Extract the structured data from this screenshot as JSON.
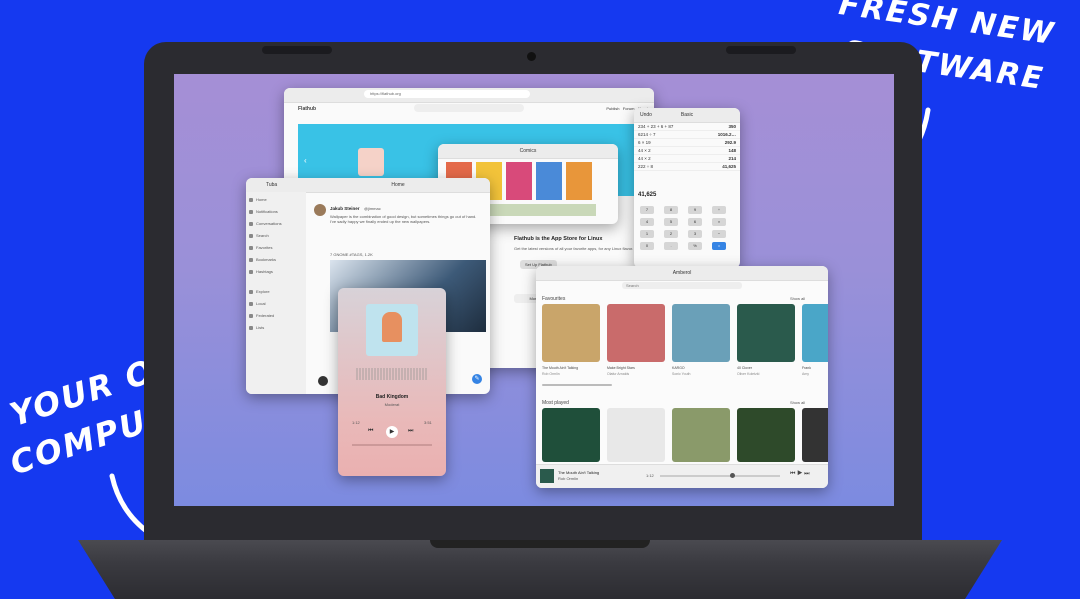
{
  "annotations": {
    "fresh": "FRESH NEW",
    "software": "SOFTWARE",
    "your_old": "YOUR OLD",
    "computer": "COMPUTER"
  },
  "flathub": {
    "url": "https://flathub.org",
    "tab": "Flathub",
    "nav": [
      "Publish",
      "Forum",
      "About"
    ],
    "headline": "Flathub is the App Store for Linux",
    "sub": "Get the latest versions of all your favorite apps, for any Linux flavor.",
    "button": "Set Up Flathub",
    "more": "More"
  },
  "comics": {
    "title": "Comics"
  },
  "calculator": {
    "mode": "Basic",
    "undo": "Undo",
    "rows": [
      {
        "expr": "234 + 23 + 6 + 87",
        "val": "350"
      },
      {
        "expr": "6214 ÷ 7",
        "val": "1016.2…"
      },
      {
        "expr": "6 × 19",
        "val": "292.9"
      },
      {
        "expr": "44 × 2",
        "val": "148"
      },
      {
        "expr": "44 × 2",
        "val": "214"
      },
      {
        "expr": "222 ÷ 8",
        "val": "41,625"
      }
    ],
    "result": "41,625",
    "keys": [
      "7",
      "8",
      "9",
      "÷",
      "4",
      "5",
      "6",
      "×",
      "1",
      "2",
      "3",
      "−",
      "0",
      ".",
      "%",
      "="
    ]
  },
  "tootle": {
    "title": "Tuba",
    "home": "Home",
    "sidebar": [
      "Home",
      "Notifications",
      "Conversations",
      "Search",
      "Favorites",
      "Bookmarks",
      "Hashtags",
      "Explore",
      "Local",
      "Federated",
      "Lists"
    ],
    "author": "Jakub Steiner",
    "handle": "@jimmac",
    "post": "Wallpaper is the combination of good design, but sometimes things go out of hand. I've sadly happy we finally ended up the new wallpapers.",
    "tags": "7 GNOME #TAGS, 1.2K"
  },
  "music": {
    "track": "Bad Kingdom",
    "artist": "Moderat",
    "elapsed": "1:12",
    "total": "3:51"
  },
  "store": {
    "title": "Amberol",
    "search": "Search",
    "fav_label": "Favourites",
    "recent_label": "Most played",
    "show_all": "Show all",
    "favs": [
      {
        "title": "The Mouth Ain't Talking",
        "artist": "Rob Ormlin",
        "color": "#c9a56a"
      },
      {
        "title": "Make Bright Stars",
        "artist": "Olafur Arnalds",
        "color": "#c96b6b"
      },
      {
        "title": "KARGO",
        "artist": "Sonic Youth",
        "color": "#6aa0b8"
      },
      {
        "title": "40 Clover",
        "artist": "Oliver Koletzki",
        "color": "#2a5a4c"
      },
      {
        "title": "Frank",
        "artist": "Amy",
        "color": "#4aa6c8"
      }
    ],
    "recent": [
      {
        "color": "#1f4f3a"
      },
      {
        "color": "#e8e8e8"
      },
      {
        "color": "#8a9a6a"
      },
      {
        "color": "#2e4a2a"
      },
      {
        "color": "#333"
      }
    ],
    "player_track": "The Mouth Ain't Talking",
    "player_artist": "Rob Ormlin",
    "player_time": "1:12"
  }
}
